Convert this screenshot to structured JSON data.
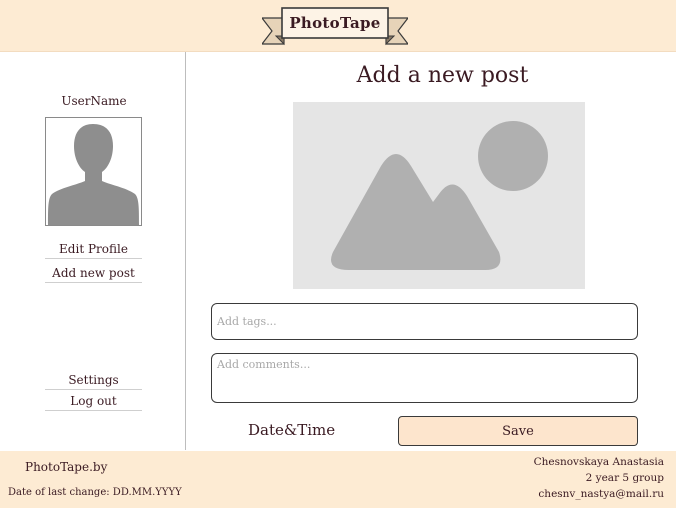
{
  "header": {
    "logo_text": "PhotoTape"
  },
  "sidebar": {
    "username": "UserName",
    "links": [
      {
        "label": "Edit Profile"
      },
      {
        "label": "Add new post"
      },
      {
        "label": "Settings"
      },
      {
        "label": "Log out"
      }
    ]
  },
  "main": {
    "title": "Add a new post",
    "tags_placeholder": "Add tags...",
    "comments_placeholder": "Add comments...",
    "datetime_label": "Date&Time",
    "save_label": "Save"
  },
  "footer": {
    "site": "PhotoTape.by",
    "last_change": "Date of last change: DD.MM.YYYY",
    "author_name": "Chesnovskaya Anastasia",
    "author_group": "2 year 5 group",
    "author_email": "chesnv_nastya@mail.ru"
  },
  "colors": {
    "header_bg": "#fdebd3",
    "text": "#3a1a22",
    "button_bg": "#fde5cd",
    "placeholder_gray": "#e5e5e5"
  }
}
